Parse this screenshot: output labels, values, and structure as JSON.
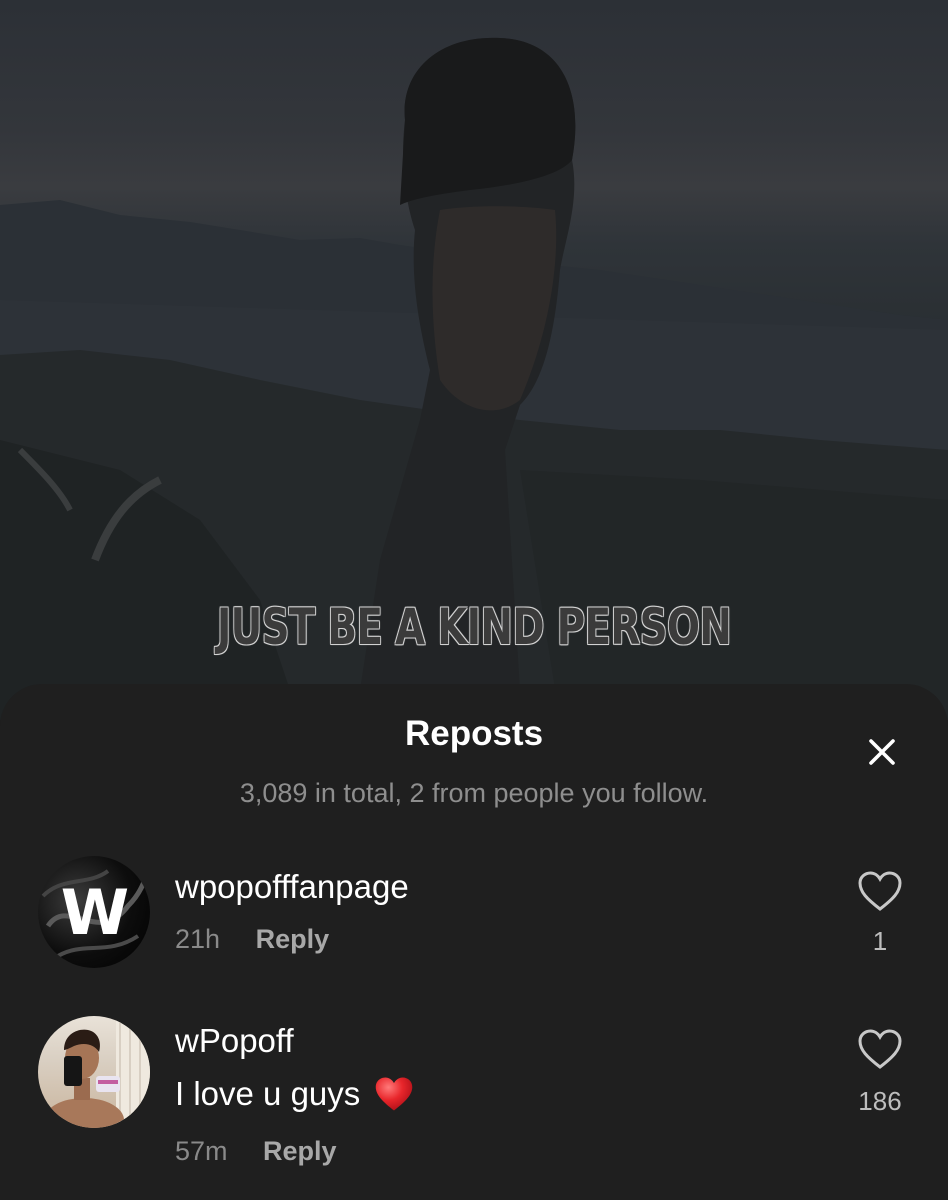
{
  "video": {
    "caption": "JUST BE A KIND PERSON"
  },
  "sheet": {
    "title": "Reposts",
    "subtitle": "3,089 in total, 2 from people you follow.",
    "close_icon": "close-icon"
  },
  "comments": [
    {
      "username": "wpopofffanpage",
      "avatar_letter": "W",
      "text": "",
      "time": "21h",
      "reply_label": "Reply",
      "likes": "1"
    },
    {
      "username": "wPopoff",
      "text": "I love u guys",
      "emoji": "red-heart",
      "time": "57m",
      "reply_label": "Reply",
      "likes": "186"
    }
  ],
  "colors": {
    "sheet_bg": "#1f1f1f",
    "secondary_text": "#8e8e8e",
    "emoji_heart": "#e8262b"
  }
}
